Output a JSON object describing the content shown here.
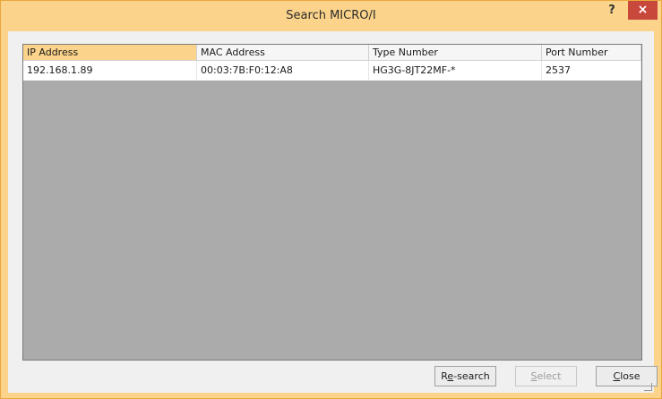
{
  "window": {
    "title": "Search MICRO/I",
    "help_label": "?",
    "close_label": "×"
  },
  "table": {
    "columns": [
      "IP Address",
      "MAC Address",
      "Type Number",
      "Port Number"
    ],
    "rows": [
      [
        "192.168.1.89",
        "00:03:7B:F0:12:A8",
        "HG3G-8JT22MF-*",
        "2537"
      ]
    ]
  },
  "buttons": {
    "research": {
      "pre": "R",
      "mnemonic": "e",
      "post": "-search"
    },
    "select": {
      "pre": "",
      "mnemonic": "S",
      "post": "elect"
    },
    "close": {
      "pre": "",
      "mnemonic": "C",
      "post": "lose"
    }
  },
  "colors": {
    "accent": "#fbd38a",
    "close_button": "#c9483c",
    "grid_background": "#ababab"
  }
}
